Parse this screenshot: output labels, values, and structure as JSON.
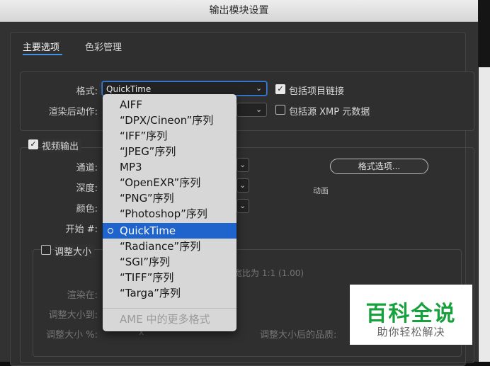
{
  "window": {
    "title": "输出模块设置"
  },
  "tabs": [
    {
      "label": "主要选项"
    },
    {
      "label": "色彩管理"
    }
  ],
  "top_group": {
    "format_label": "格式:",
    "format_value": "QuickTime",
    "post_render_label": "渲染后动作:",
    "include_project_link": {
      "label": "包括项目链接",
      "checked": true
    },
    "include_xmp": {
      "label": "包括源 XMP 元数据",
      "checked": false
    }
  },
  "video": {
    "enabled_label": "视频输出",
    "channel_label": "通道:",
    "depth_label": "深度:",
    "color_label": "颜色:",
    "start_label": "开始 #:",
    "format_options_button": "格式选项...",
    "codec_hint": "动画"
  },
  "resize": {
    "label": "调整大小",
    "aspect_text": "宽比为 1:1 (1.00)",
    "render_at_label": "渲染在:",
    "resize_to_label": "调整大小到:",
    "resize_pct_label": "调整大小 %:",
    "pct_x": "x",
    "quality_label": "调整大小后的品质:"
  },
  "format_menu": {
    "items": [
      {
        "label": "AIFF"
      },
      {
        "label": "“DPX/Cineon”序列"
      },
      {
        "label": "“IFF”序列"
      },
      {
        "label": "“JPEG”序列"
      },
      {
        "label": "MP3"
      },
      {
        "label": "“OpenEXR”序列"
      },
      {
        "label": "“PNG”序列"
      },
      {
        "label": "“Photoshop”序列"
      },
      {
        "label": "QuickTime"
      },
      {
        "label": "“Radiance”序列"
      },
      {
        "label": "“SGI”序列"
      },
      {
        "label": "“TIFF”序列"
      },
      {
        "label": "“Targa”序列"
      }
    ],
    "selected_index": 8,
    "more_formats": "AME 中的更多格式"
  },
  "watermark": {
    "title": "百科全说",
    "subtitle": "助你轻松解决"
  },
  "colors": {
    "accent": "#1f63cc",
    "watermark_green": "#17a13d"
  }
}
